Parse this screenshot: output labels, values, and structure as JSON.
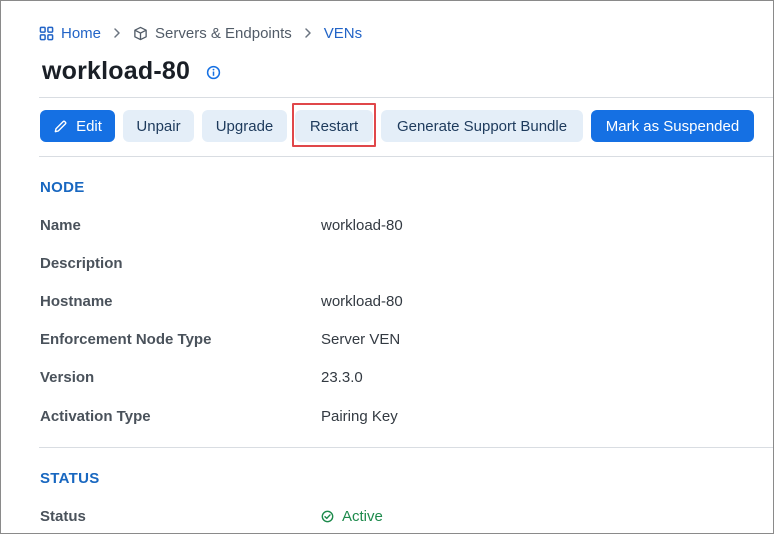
{
  "breadcrumb": {
    "home": "Home",
    "servers": "Servers & Endpoints",
    "vens": "VENs"
  },
  "page": {
    "title": "workload-80"
  },
  "toolbar": {
    "edit": "Edit",
    "unpair": "Unpair",
    "upgrade": "Upgrade",
    "restart": "Restart",
    "support_bundle": "Generate Support Bundle",
    "suspend": "Mark as Suspended"
  },
  "node": {
    "heading": "NODE",
    "name_label": "Name",
    "name_value": "workload-80",
    "description_label": "Description",
    "description_value": "",
    "hostname_label": "Hostname",
    "hostname_value": "workload-80",
    "type_label": "Enforcement Node Type",
    "type_value": "Server VEN",
    "version_label": "Version",
    "version_value": "23.3.0",
    "activation_label": "Activation Type",
    "activation_value": "Pairing Key"
  },
  "status": {
    "heading": "STATUS",
    "status_label": "Status",
    "status_value": "Active"
  },
  "colors": {
    "primary": "#1570e3",
    "secondary_bg": "#e4eef8",
    "link": "#2264c7",
    "section": "#1867c0",
    "active": "#1d8a4c",
    "highlight": "#e0474a"
  }
}
